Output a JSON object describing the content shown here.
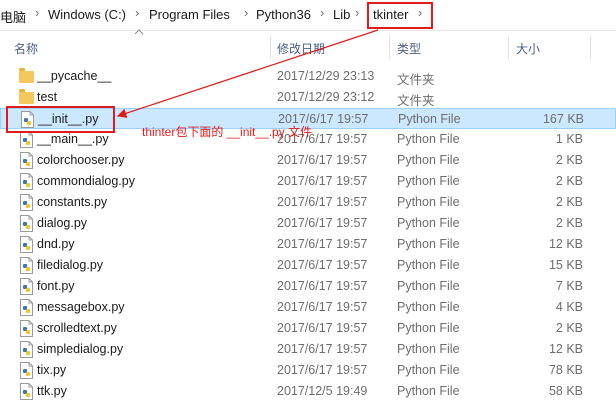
{
  "breadcrumb": {
    "items": [
      "电脑",
      "Windows (C:)",
      "Program Files",
      "Python36",
      "Lib",
      "tkinter"
    ],
    "separator": "›"
  },
  "columns": {
    "name": "名称",
    "date": "修改日期",
    "type": "类型",
    "size": "大小"
  },
  "rows": [
    {
      "name": "__pycache__",
      "date": "2017/12/29 23:13",
      "type": "文件夹",
      "size": "",
      "kind": "folder"
    },
    {
      "name": "test",
      "date": "2017/12/29 23:12",
      "type": "文件夹",
      "size": "",
      "kind": "folder"
    },
    {
      "name": "__init__.py",
      "date": "2017/6/17 19:57",
      "type": "Python File",
      "size": "167 KB",
      "kind": "python",
      "selected": true
    },
    {
      "name": "__main__.py",
      "date": "2017/6/17 19:57",
      "type": "Python File",
      "size": "1 KB",
      "kind": "python"
    },
    {
      "name": "colorchooser.py",
      "date": "2017/6/17 19:57",
      "type": "Python File",
      "size": "2 KB",
      "kind": "python"
    },
    {
      "name": "commondialog.py",
      "date": "2017/6/17 19:57",
      "type": "Python File",
      "size": "2 KB",
      "kind": "python"
    },
    {
      "name": "constants.py",
      "date": "2017/6/17 19:57",
      "type": "Python File",
      "size": "2 KB",
      "kind": "python"
    },
    {
      "name": "dialog.py",
      "date": "2017/6/17 19:57",
      "type": "Python File",
      "size": "2 KB",
      "kind": "python"
    },
    {
      "name": "dnd.py",
      "date": "2017/6/17 19:57",
      "type": "Python File",
      "size": "12 KB",
      "kind": "python"
    },
    {
      "name": "filedialog.py",
      "date": "2017/6/17 19:57",
      "type": "Python File",
      "size": "15 KB",
      "kind": "python"
    },
    {
      "name": "font.py",
      "date": "2017/6/17 19:57",
      "type": "Python File",
      "size": "7 KB",
      "kind": "python"
    },
    {
      "name": "messagebox.py",
      "date": "2017/6/17 19:57",
      "type": "Python File",
      "size": "4 KB",
      "kind": "python"
    },
    {
      "name": "scrolledtext.py",
      "date": "2017/6/17 19:57",
      "type": "Python File",
      "size": "2 KB",
      "kind": "python"
    },
    {
      "name": "simpledialog.py",
      "date": "2017/6/17 19:57",
      "type": "Python File",
      "size": "12 KB",
      "kind": "python"
    },
    {
      "name": "tix.py",
      "date": "2017/6/17 19:57",
      "type": "Python File",
      "size": "78 KB",
      "kind": "python"
    },
    {
      "name": "ttk.py",
      "date": "2017/12/5 19:49",
      "type": "Python File",
      "size": "58 KB",
      "kind": "python"
    }
  ],
  "annotation": {
    "text": "thinter包下面的 __init__.py 文件",
    "color": "#e01b1b"
  },
  "colors": {
    "selection": "#cce8ff",
    "highlight": "#e01b1b",
    "header_text": "#4d6082"
  }
}
